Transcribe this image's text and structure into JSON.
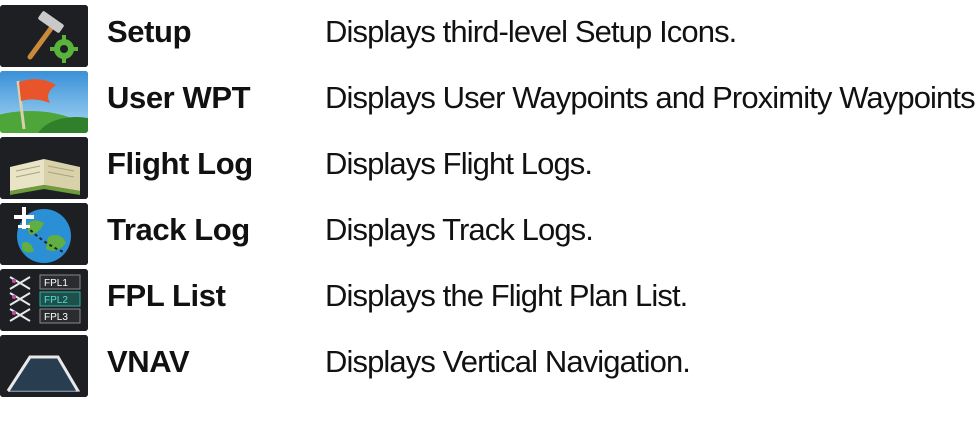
{
  "rows": [
    {
      "icon": "setup-icon",
      "name": "Setup",
      "description": "Displays third-level Setup Icons."
    },
    {
      "icon": "user-wpt-flag-icon",
      "name": "User WPT",
      "description": "Displays User Waypoints and Proximity Waypoints."
    },
    {
      "icon": "flight-log-book-icon",
      "name": "Flight Log",
      "description": "Displays Flight Logs."
    },
    {
      "icon": "track-log-globe-icon",
      "name": "Track Log",
      "description": "Displays Track Logs."
    },
    {
      "icon": "fpl-list-icon",
      "name": "FPL List",
      "description": "Displays the Flight Plan List.",
      "icon_labels": [
        "FPL1",
        "FPL2",
        "FPL3"
      ]
    },
    {
      "icon": "vnav-profile-icon",
      "name": "VNAV",
      "description": "Displays Vertical Navigation."
    }
  ],
  "colors": {
    "icon_bg": "#1b1d21",
    "text": "#111111",
    "gear": "#5ab33a",
    "fpl_active": "#2bb3a6"
  }
}
